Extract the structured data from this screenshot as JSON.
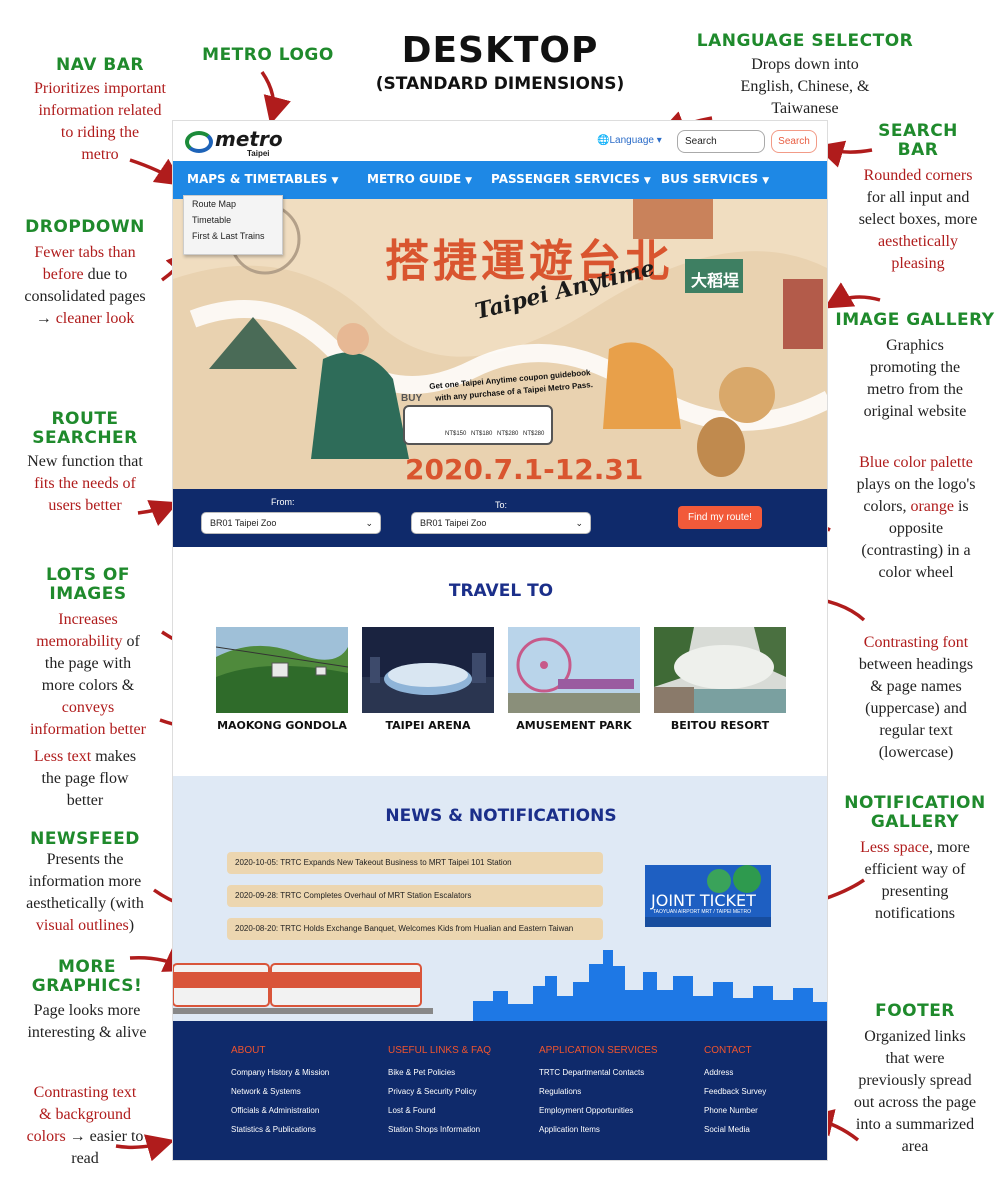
{
  "header": {
    "title": "DESKTOP",
    "subtitle": "(STANDARD DIMENSIONS)"
  },
  "annotations": {
    "nav_bar": {
      "title": "NAV BAR",
      "line1": "Prioritizes important",
      "line2": "information related",
      "line3": "to riding the",
      "line4": "metro"
    },
    "metro_logo": {
      "title": "METRO LOGO"
    },
    "language_selector": {
      "title": "LANGUAGE SELECTOR",
      "line1": "Drops down into",
      "line2": "English, Chinese, &",
      "line3": "Taiwanese"
    },
    "search_bar": {
      "title1": "SEARCH",
      "title2": "BAR",
      "red": "Rounded corners",
      "line1": "for all input and",
      "line2": "select boxes, more",
      "red2": "aesthetically",
      "red3": "pleasing"
    },
    "dropdown": {
      "title": "DROPDOWN",
      "red1": "Fewer tabs than",
      "red2": "before",
      "line1": " due to",
      "line2": "consolidated pages",
      "line3": "→ ",
      "red3": "cleaner look"
    },
    "image_gallery": {
      "title": "IMAGE GALLERY",
      "line1": "Graphics",
      "line2": "promoting the",
      "line3": "metro from the",
      "line4": "original website"
    },
    "route_searcher": {
      "title1": "ROUTE",
      "title2": "SEARCHER",
      "line1": "New function that",
      "red1": "fits the needs of",
      "red2": "users better"
    },
    "blue_palette": {
      "red1": "Blue color palette",
      "line1": "plays on the logo's",
      "line2": "colors, ",
      "red2": "orange",
      "line3": " is",
      "line4": "opposite",
      "line5": "(contrasting) in a",
      "line6": "color wheel"
    },
    "lots_images": {
      "title": "LOTS OF IMAGES",
      "red1": "Increases",
      "red2": "memorability",
      "line1": " of",
      "line2": "the page with",
      "line3": "more colors &",
      "red3": "conveys",
      "red4": "information better"
    },
    "contrasting_font": {
      "red1": "Contrasting font",
      "line1": "between headings",
      "line2": "& page names",
      "line3": "(uppercase) and",
      "line4": "regular text",
      "line5": "(lowercase)"
    },
    "less_text": {
      "red1": "Less text",
      "line1": " makes",
      "line2": "the page flow",
      "line3": "better"
    },
    "newsfeed": {
      "title": "NEWSFEED",
      "line1": "Presents the",
      "line2": "information more",
      "line3": "aesthetically (with",
      "red1": "visual outlines",
      "line4": ")"
    },
    "notification_gallery": {
      "title1": "NOTIFICATION",
      "title2": "GALLERY",
      "red1": "Less space",
      "line1": ", more",
      "line2": "efficient way of",
      "line3": "presenting",
      "line4": "notifications"
    },
    "more_graphics": {
      "title1": "MORE",
      "title2": "GRAPHICS!",
      "line1": "Page looks more",
      "line2": "interesting & alive"
    },
    "footer": {
      "title": "FOOTER",
      "line1": "Organized links",
      "line2": "that were",
      "line3": "previously spread",
      "line4": "out across the page",
      "line5": "into a summarized",
      "line6": "area"
    },
    "contrasting_text": {
      "red1": "Contrasting text",
      "red2": "& background",
      "red3": "colors",
      "line1": " → easier to",
      "line2": "read"
    }
  },
  "site": {
    "logo_text": "metro",
    "logo_sub": "Taipei",
    "language_label": "Language",
    "search_placeholder": "Search",
    "search_button": "Search",
    "nav": [
      "MAPS & TIMETABLES",
      "METRO GUIDE",
      "PASSENGER SERVICES",
      "BUS SERVICES"
    ],
    "dropdown_items": [
      "Route Map",
      "Timetable",
      "First & Last Trains"
    ],
    "hero": {
      "chinese_title": "搭捷運遊台北",
      "english_title": "Taipei Anytime",
      "promo_line1": "Get one Taipei Anytime coupon guidebook",
      "promo_line2": "with any purchase of a Taipei Metro Pass.",
      "buy": "BUY",
      "date": "2020.7.1-12.31",
      "sign": "大稻埕",
      "prices": [
        "NT$150",
        "NT$180",
        "NT$280",
        "NT$280"
      ]
    },
    "route": {
      "from_label": "From:",
      "to_label": "To:",
      "from_value": "BR01 Taipei Zoo",
      "to_value": "BR01 Taipei Zoo",
      "button": "Find my route!"
    },
    "travel": {
      "heading": "TRAVEL TO",
      "items": [
        "MAOKONG GONDOLA",
        "TAIPEI ARENA",
        "AMUSEMENT PARK",
        "BEITOU RESORT"
      ]
    },
    "news": {
      "heading": "NEWS & NOTIFICATIONS",
      "items": [
        "2020-10-05: TRTC Expands New Takeout Business to MRT Taipei 101 Station",
        "2020-09-28: TRTC Completes Overhaul of MRT Station Escalators",
        "2020-08-20: TRTC Holds Exchange Banquet, Welcomes Kids from Hualian and Eastern Taiwan"
      ],
      "joint_ticket": "JOINT TICKET",
      "joint_sub": "TAOYUAN AIRPORT MRT / TAIPEI METRO"
    },
    "footer": {
      "columns": [
        {
          "heading": "ABOUT",
          "links": [
            "Company History & Mission",
            "Network & Systems",
            "Officials & Administration",
            "Statistics & Publications"
          ]
        },
        {
          "heading": "USEFUL LINKS & FAQ",
          "links": [
            "Bike & Pet Policies",
            "Privacy & Security Policy",
            "Lost & Found",
            "Station Shops Information"
          ]
        },
        {
          "heading": "APPLICATION SERVICES",
          "links": [
            "TRTC Departmental Contacts",
            "Regulations",
            "Employment Opportunities",
            "Application Items"
          ]
        },
        {
          "heading": "CONTACT",
          "links": [
            "Address",
            "Feedback Survey",
            "Phone Number",
            "Social Media"
          ]
        }
      ]
    }
  },
  "colors": {
    "annotation_green": "#1f8a2c",
    "annotation_red": "#b01c1c",
    "nav_blue": "#1e88e5",
    "navy": "#0f2a6b",
    "orange": "#f25a3a",
    "news_bg": "#dfe9f5",
    "news_item": "#ecd6b0"
  }
}
